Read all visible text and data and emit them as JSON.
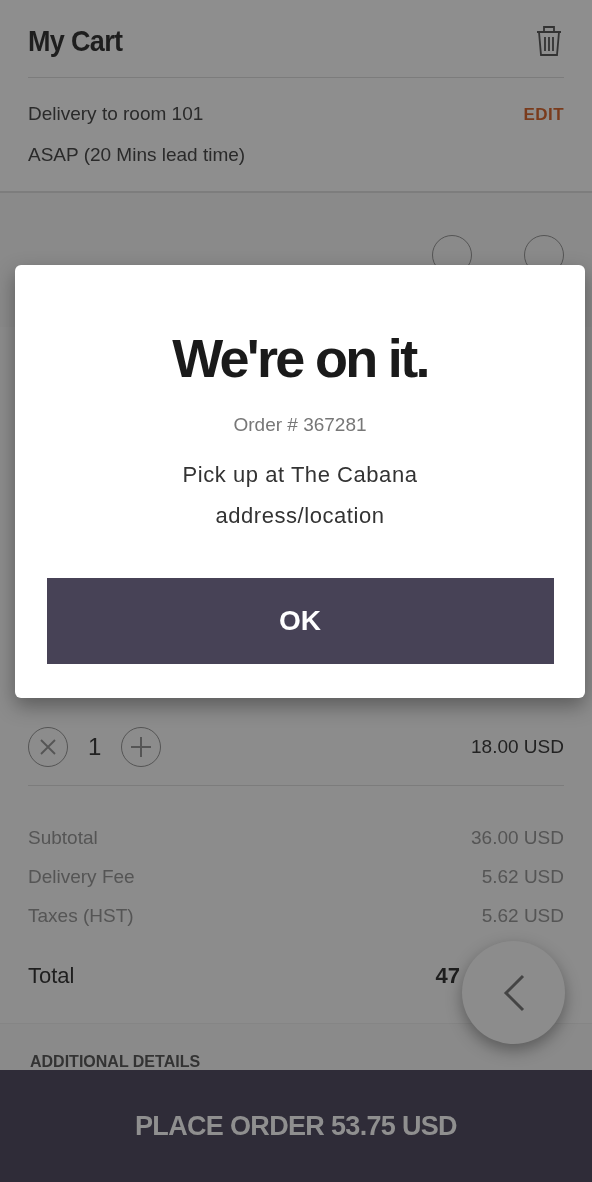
{
  "header": {
    "title": "My Cart"
  },
  "delivery": {
    "line": "Delivery to room 101",
    "edit": "EDIT",
    "timing": "ASAP (20 Mins lead time)"
  },
  "item": {
    "quantity": "1",
    "price": "18.00 USD"
  },
  "summary": [
    {
      "label": "Subtotal",
      "value": "36.00 USD",
      "kind": "line"
    },
    {
      "label": "Delivery Fee",
      "value": "5.62 USD",
      "kind": "line"
    },
    {
      "label": "Taxes (HST)",
      "value": "5.62 USD",
      "kind": "line"
    },
    {
      "label": "Total",
      "value": "47",
      "kind": "total"
    }
  ],
  "additional": {
    "heading": "ADDITIONAL DETAILS"
  },
  "place_order": "PLACE ORDER 53.75 USD",
  "dialog": {
    "title": "We're on it.",
    "order": "Order # 367281",
    "message": "Pick up at The Cabana",
    "message_2": "address/location",
    "button": "OK"
  }
}
